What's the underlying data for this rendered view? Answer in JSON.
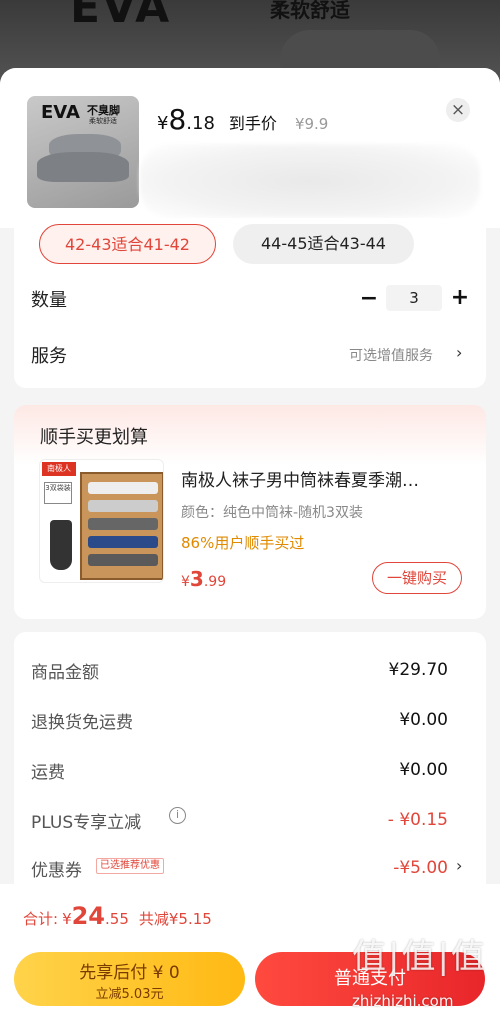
{
  "backdrop": {
    "title": "EVA",
    "subtitle": "柔软舒适"
  },
  "header": {
    "thumb_brand": "EVA",
    "thumb_tag": "不臭脚",
    "thumb_sub": "柔软舒适",
    "currency": "¥",
    "price_int": "8",
    "price_dec": ".18",
    "deal_label": "到手价",
    "original_price": "¥9.9",
    "close_symbol": "×"
  },
  "options": {
    "sizes": [
      {
        "label": "42-43适合41-42",
        "selected": true
      },
      {
        "label": "44-45适合43-44",
        "selected": false
      }
    ],
    "quantity_label": "数量",
    "quantity_value": "3",
    "minus_symbol": "−",
    "plus_symbol": "+",
    "service_label": "服务",
    "service_hint": "可选增值服务",
    "arrow": "›"
  },
  "bundle": {
    "title": "顺手买更划算",
    "brand_label": "南极人",
    "pack_badge": "3双袋装",
    "product_name": "南极人袜子男中筒袜春夏季潮…",
    "variant": "颜色：纯色中筒袜-随机3双装",
    "social_proof": "86%用户顺手买过",
    "currency": "¥",
    "price_int": "3",
    "price_dec": ".99",
    "buy_button": "一键购买"
  },
  "summary": {
    "rows": [
      {
        "label": "商品金额",
        "value": "¥29.70"
      },
      {
        "label": "退换货免运费",
        "value": "¥0.00"
      },
      {
        "label": "运费",
        "value": "¥0.00"
      },
      {
        "label": "PLUS专享立减",
        "value": "- ¥0.15"
      },
      {
        "label": "优惠券",
        "value": "-¥5.00"
      }
    ],
    "info_symbol": "i",
    "coupon_tag": "已选推荐优惠",
    "arrow": "›"
  },
  "footer": {
    "total_label": "合计:",
    "currency": "¥",
    "total_int": "24",
    "total_dec": ".55",
    "savings": "共减¥5.15",
    "pay_later_line1": "先享后付 ¥ 0",
    "pay_later_line2": "立减5.03元",
    "pay_normal": "普通支付",
    "watermark": "值|值|值",
    "watermark_url": "zhizhizhi.com"
  },
  "colors": {
    "accent": "#e0463a",
    "gold": "#ffc22a",
    "social": "#e08a00"
  }
}
